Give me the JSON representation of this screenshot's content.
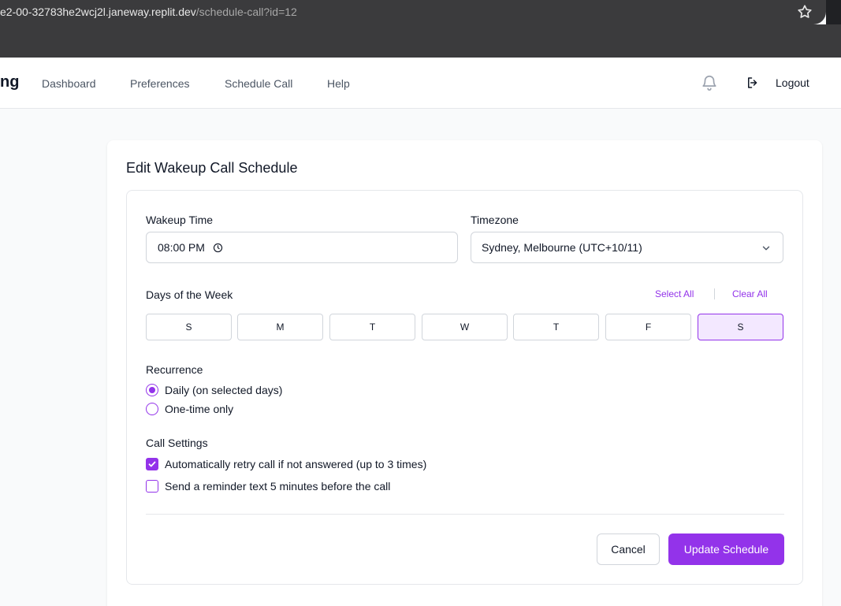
{
  "browser": {
    "url_host": "e2-00-32783he2wcj2l.janeway.replit.dev",
    "url_path": "/schedule-call?id=12"
  },
  "nav": {
    "brand": "ng",
    "links": [
      "Dashboard",
      "Preferences",
      "Schedule Call",
      "Help"
    ],
    "logout_label": "Logout"
  },
  "card": {
    "title": "Edit Wakeup Call Schedule"
  },
  "form": {
    "wakeup_label": "Wakeup Time",
    "wakeup_value": "08:00 PM",
    "timezone_label": "Timezone",
    "timezone_value": "Sydney, Melbourne (UTC+10/11)",
    "days_label": "Days of the Week",
    "select_all": "Select All",
    "clear_all": "Clear All",
    "days": [
      {
        "label": "S",
        "selected": false
      },
      {
        "label": "M",
        "selected": false
      },
      {
        "label": "T",
        "selected": false
      },
      {
        "label": "W",
        "selected": false
      },
      {
        "label": "T",
        "selected": false
      },
      {
        "label": "F",
        "selected": false
      },
      {
        "label": "S",
        "selected": true
      }
    ],
    "recurrence_label": "Recurrence",
    "recurrence_options": [
      {
        "label": "Daily (on selected days)",
        "checked": true
      },
      {
        "label": "One-time only",
        "checked": false
      }
    ],
    "call_settings_label": "Call Settings",
    "call_settings": [
      {
        "label": "Automatically retry call if not answered (up to 3 times)",
        "checked": true
      },
      {
        "label": "Send a reminder text 5 minutes before the call",
        "checked": false
      }
    ],
    "cancel_label": "Cancel",
    "update_label": "Update Schedule"
  },
  "colors": {
    "accent": "#9333ea",
    "accent_light": "#f3e8ff"
  }
}
